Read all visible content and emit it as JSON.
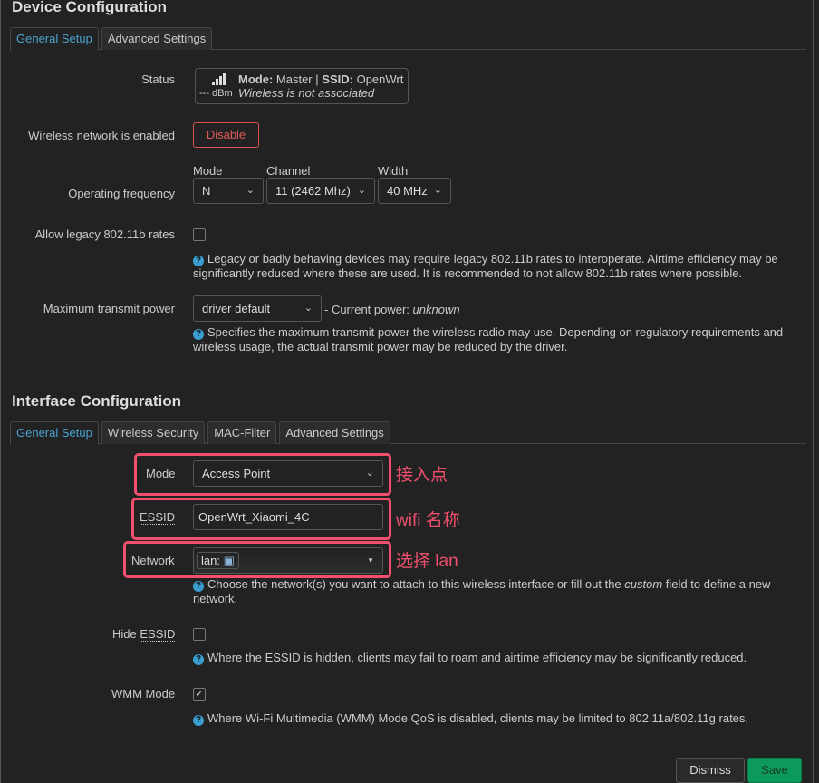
{
  "device": {
    "title": "Device Configuration",
    "tabs": [
      "General Setup",
      "Advanced Settings"
    ],
    "status_label": "Status",
    "status_signal": "--- dBm",
    "status_mode_key": "Mode:",
    "status_mode": "Master",
    "status_sep": "|",
    "status_ssid_key": "SSID:",
    "status_ssid": "OpenWrt",
    "status_msg": "Wireless is not associated",
    "enabled_label": "Wireless network is enabled",
    "disable_btn": "Disable",
    "freq_label": "Operating frequency",
    "mode_hdr": "Mode",
    "mode_val": "N",
    "channel_hdr": "Channel",
    "channel_val": "11 (2462 Mhz)",
    "width_hdr": "Width",
    "width_val": "40 MHz",
    "legacy_label": "Allow legacy 802.11b rates",
    "legacy_checked": false,
    "legacy_help": "Legacy or badly behaving devices may require legacy 802.11b rates to interoperate. Airtime efficiency may be significantly reduced where these are used. It is recommended to not allow 802.11b rates where possible.",
    "txpower_label": "Maximum transmit power",
    "txpower_val": "driver default",
    "txpower_current": "- Current power:",
    "txpower_current_val": "unknown",
    "txpower_help": "Specifies the maximum transmit power the wireless radio may use. Depending on regulatory requirements and wireless usage, the actual transmit power may be reduced by the driver."
  },
  "iface": {
    "title": "Interface Configuration",
    "tabs": [
      "General Setup",
      "Wireless Security",
      "MAC-Filter",
      "Advanced Settings"
    ],
    "mode_label": "Mode",
    "mode_val": "Access Point",
    "essid_label": "ESSID",
    "essid_val": "OpenWrt_Xiaomi_4C",
    "network_label": "Network",
    "network_val": "lan:",
    "network_help_a": "Choose the network(s) you want to attach to this wireless interface or fill out the ",
    "network_help_em": "custom",
    "network_help_b": " field to define a new network.",
    "hide_label_a": "Hide ",
    "hide_label_b": "ESSID",
    "hide_checked": false,
    "hide_help": "Where the ESSID is hidden, clients may fail to roam and airtime efficiency may be significantly reduced.",
    "wmm_label": "WMM Mode",
    "wmm_checked": true,
    "wmm_help": "Where Wi-Fi Multimedia (WMM) Mode QoS is disabled, clients may be limited to 802.11a/802.11g rates."
  },
  "annotations": {
    "mode": "接入点",
    "essid": "wifi 名称",
    "network": "选择 lan",
    "color": "#f0506e"
  },
  "footer": {
    "dismiss": "Dismiss",
    "save": "Save"
  }
}
